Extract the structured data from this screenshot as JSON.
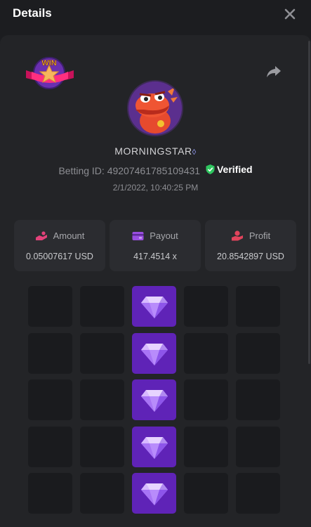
{
  "header": {
    "title": "Details"
  },
  "badge": {
    "text": "WIN"
  },
  "player": {
    "username": "MORNINGSTAR",
    "betting_id_label": "Betting ID:",
    "betting_id": "49207461785109431",
    "verified_label": "Verified",
    "timestamp": "2/1/2022, 10:40:25 PM"
  },
  "stats": [
    {
      "label": "Amount",
      "value": "0.05007617 USD",
      "icon": "coins-hand-icon",
      "color": "#e2427a"
    },
    {
      "label": "Payout",
      "value": "417.4514 x",
      "icon": "wallet-icon",
      "color": "#9a4ee0"
    },
    {
      "label": "Profit",
      "value": "20.8542897 USD",
      "icon": "money-hand-icon",
      "color": "#e2445c"
    }
  ],
  "grid": {
    "rows": 5,
    "cols": 5,
    "cells": [
      [
        "empty",
        "empty",
        "gem",
        "empty",
        "empty"
      ],
      [
        "empty",
        "empty",
        "gem",
        "empty",
        "empty"
      ],
      [
        "empty",
        "empty",
        "gem",
        "empty",
        "empty"
      ],
      [
        "empty",
        "empty",
        "gem",
        "empty",
        "empty"
      ],
      [
        "empty",
        "empty",
        "gem",
        "empty",
        "empty"
      ]
    ]
  },
  "colors": {
    "background": "#1c1d20",
    "panel": "#232427",
    "card": "#2b2c30",
    "cell": "#1a1b1e",
    "gem_cell": "#5f23b7",
    "verified": "#2fc55f"
  }
}
